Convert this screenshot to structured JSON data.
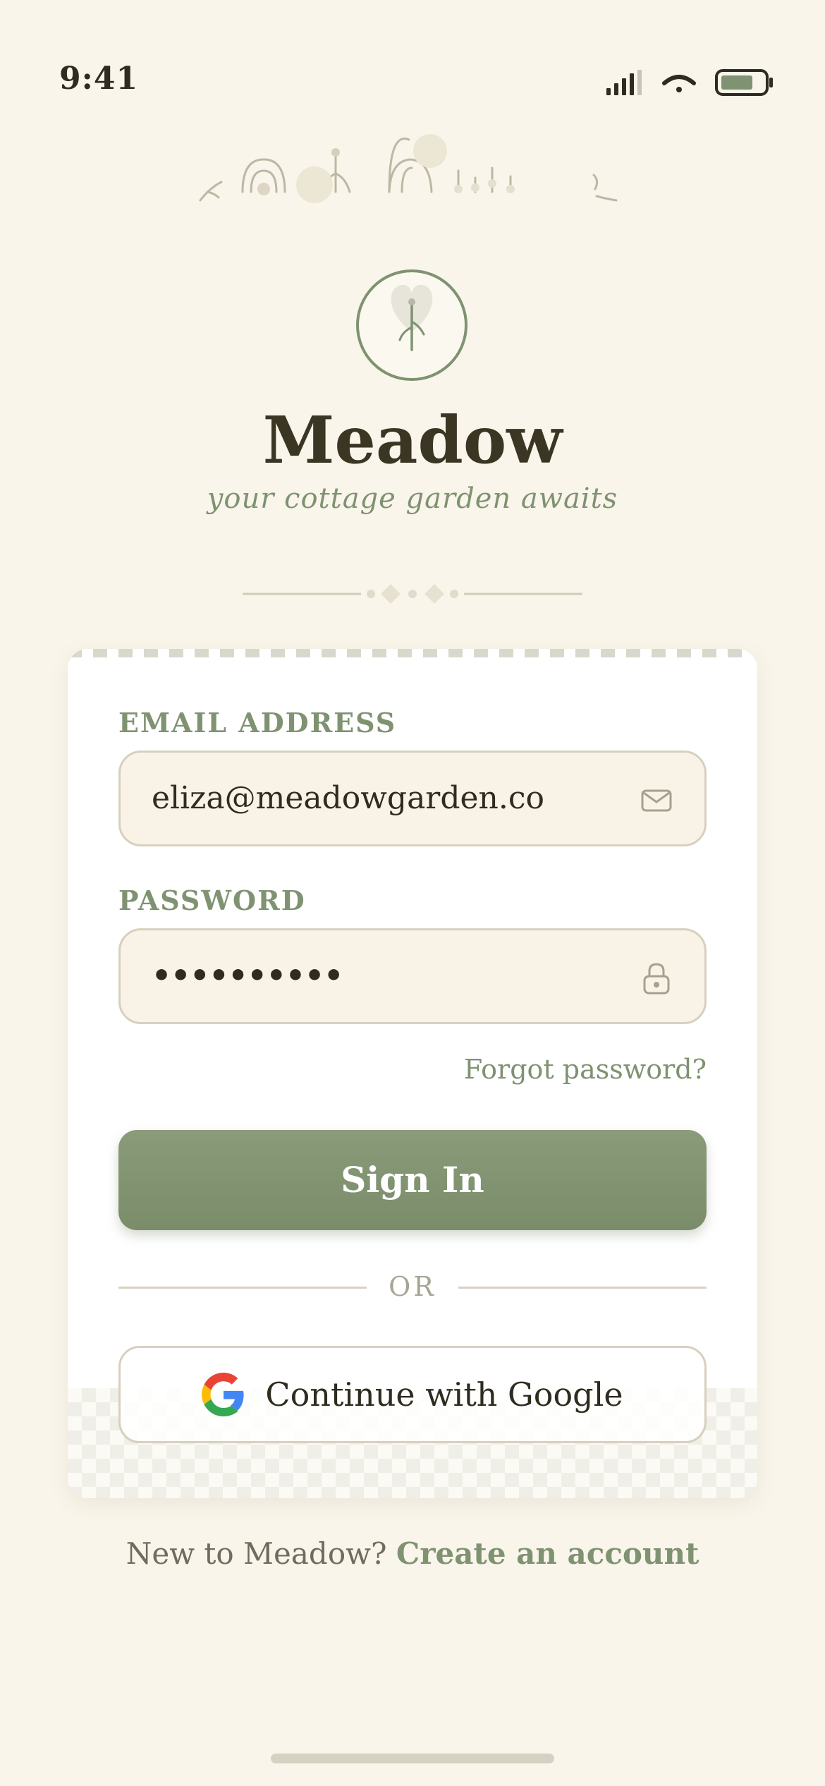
{
  "status_bar": {
    "time": "9:41",
    "signal_icon": "cellular-signal-icon",
    "wifi_icon": "wifi-icon",
    "battery_icon": "battery-icon"
  },
  "brand": {
    "name": "Meadow",
    "tagline": "your cottage garden awaits",
    "logo_icon": "sprout-heart-icon"
  },
  "form": {
    "email": {
      "label": "EMAIL ADDRESS",
      "value": "eliza@meadowgarden.co",
      "icon": "mail-icon"
    },
    "password": {
      "label": "PASSWORD",
      "value": "••••••••••",
      "icon": "lock-icon"
    },
    "forgot_label": "Forgot password?",
    "signin_label": "Sign In",
    "or_label": "OR",
    "google_label": "Continue with Google",
    "google_icon": "google-icon"
  },
  "footer": {
    "prompt": "New to Meadow? ",
    "create_label": "Create an account"
  },
  "colors": {
    "background": "#f9f5ea",
    "accent": "#7f9271",
    "text": "#3a3623"
  }
}
